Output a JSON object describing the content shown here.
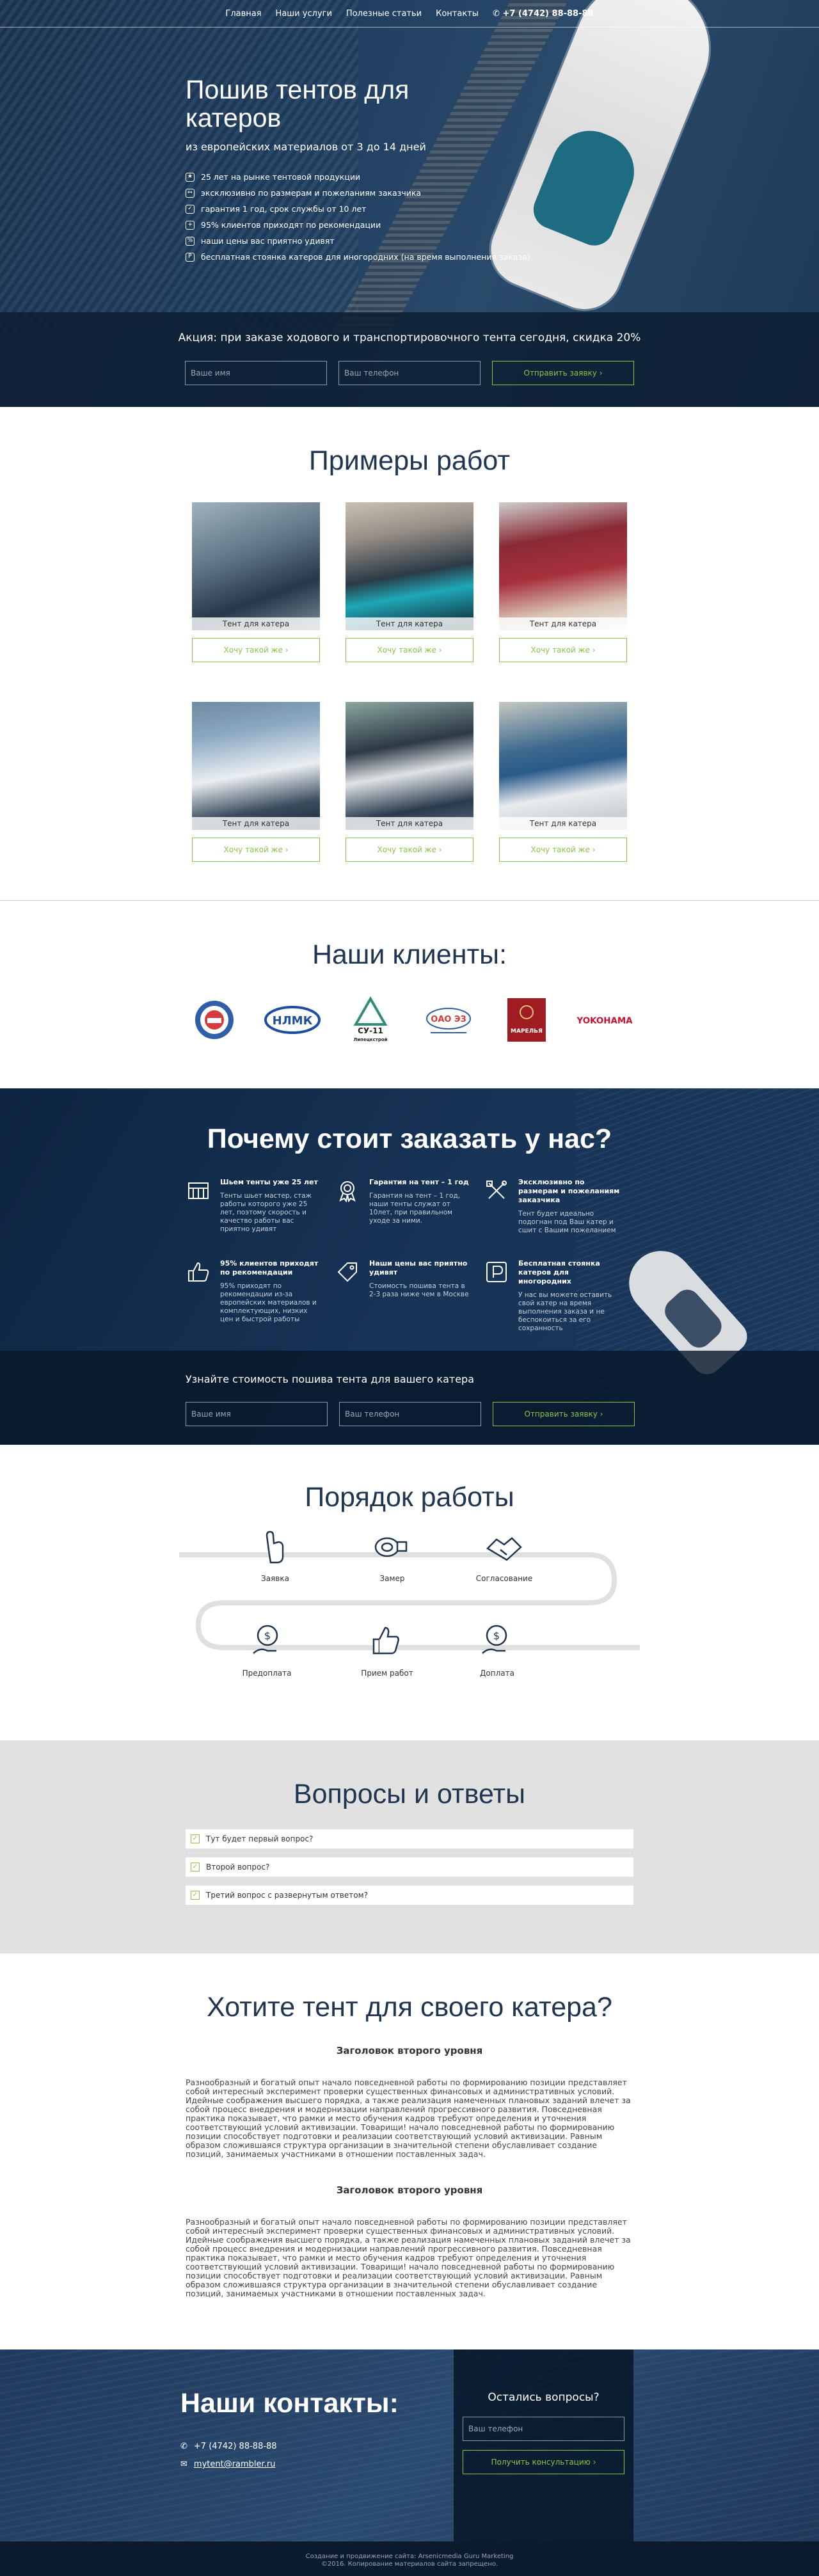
{
  "nav": {
    "items": [
      "Главная",
      "Наши услуги",
      "Полезные статьи",
      "Контакты"
    ],
    "phone": "+7 (4742) 88-88-88"
  },
  "hero": {
    "title": "Пошив тентов для катеров",
    "subtitle": "из европейских материалов от 3 до 14 дней",
    "features": [
      "25 лет на рынке тентовой продукции",
      "эксклюзивно по размерам и пожеланиям заказчика",
      "гарантия 1 год, срок службы от 10 лет",
      "95% клиентов приходят по рекомендации",
      "наши цены вас приятно удивят",
      "бесплатная стоянка катеров для иногородних (на время выполнения заказа)"
    ],
    "promo": "Акция: при заказе ходового и транспортировочного тента сегодня, скидка 20%",
    "name_placeholder": "Ваше имя",
    "phone_placeholder": "Ваш телефон",
    "submit": "Отправить заявку ›"
  },
  "works": {
    "title": "Примеры работ",
    "items": [
      {
        "caption": "Тент для катера",
        "button": "Хочу такой же ›"
      },
      {
        "caption": "Тент для катера",
        "button": "Хочу такой же ›"
      },
      {
        "caption": "Тент для катера",
        "button": "Хочу такой же ›"
      },
      {
        "caption": "Тент для катера",
        "button": "Хочу такой же ›"
      },
      {
        "caption": "Тент для катера",
        "button": "Хочу такой же ›"
      },
      {
        "caption": "Тент для катера",
        "button": "Хочу такой же ›"
      }
    ]
  },
  "clients": {
    "title": "Наши клиенты:",
    "logos": [
      "НЛМК",
      "СУ-11",
      "ОАО ЭЗ",
      "МАРЕЛЬЯ",
      "YOKOHAMA"
    ],
    "su11_sub": "Липецкстрой"
  },
  "why": {
    "title": "Почему стоит заказать у нас?",
    "items": [
      {
        "title": "Шьем тенты уже 25 лет",
        "text": "Тенты шьет мастер, стаж работы которого уже 25 лет, поэтому скорость и качество работы вас приятно удивят"
      },
      {
        "title": "Гарантия на тент – 1 год",
        "text": "Гарантия на тент – 1 год, наши тенты служат от 10лет, при правильном уходе за ними."
      },
      {
        "title": "Эксклюзивно по размерам и пожеланиям заказчика",
        "text": "Тент будет идеально подогнан под Ваш катер и сшит с Вашим пожеланием"
      },
      {
        "title": "95% клиентов приходят по рекомендации",
        "text": "95% приходят по рекомендации из-за европейских материалов и комплектующих, низких цен и быстрой работы"
      },
      {
        "title": "Наши цены вас приятно удивят",
        "text": "Стоимость пошива тента в 2-3 раза ниже чем в Москве"
      },
      {
        "title": "Бесплатная стоянка катеров для иногородних",
        "text": "У нас вы можете оставить свой катер на время выполнения заказа и не беспокоиться за его сохранность"
      }
    ],
    "bar_title": "Узнайте стоимость пошива тента для вашего катера",
    "name_placeholder": "Ваше имя",
    "phone_placeholder": "Ваш телефон",
    "submit": "Отправить заявку ›"
  },
  "process": {
    "title": "Порядок работы",
    "steps": [
      "Заявка",
      "Замер",
      "Согласование",
      "Предоплата",
      "Прием работ",
      "Доплата"
    ]
  },
  "faq": {
    "title": "Вопросы и ответы",
    "items": [
      "Тут будет первый вопрос?",
      "Второй вопрос?",
      "Третий вопрос с развернутым ответом?"
    ]
  },
  "text": {
    "title": "Хотите тент для своего катера?",
    "h2a": "Заголовок второго уровня",
    "p1": "Разнообразный и богатый опыт начало повседневной работы по формированию позиции представляет собой интересный эксперимент проверки существенных финансовых и административных условий. Идейные соображения высшего порядка, а также реализация намеченных плановых заданий влечет за собой процесс внедрения и модернизации направлений прогрессивного развития. Повседневная практика показывает, что рамки и место обучения кадров требуют определения и уточнения соответствующий условий активизации. Товарищи! начало повседневной работы по формированию позиции способствует подготовки и реализации соответствующий условий активизации. Равным образом сложившаяся структура организации в значительной степени обуславливает создание позиций, занимаемых участниками в отношении поставленных задач.",
    "h2b": "Заголовок второго уровня",
    "p2": "Разнообразный и богатый опыт начало повседневной работы по формированию позиции представляет собой интересный эксперимент проверки существенных финансовых и административных условий. Идейные соображения высшего порядка, а также реализация намеченных плановых заданий влечет за собой процесс внедрения и модернизации направлений прогрессивного развития. Повседневная практика показывает, что рамки и место обучения кадров требуют определения и уточнения соответствующий условий активизации. Товарищи! начало повседневной работы по формированию позиции способствует подготовки и реализации соответствующий условий активизации. Равным образом сложившаяся структура организации в значительной степени обуславливает создание позиций, занимаемых участниками в отношении поставленных задач."
  },
  "contacts": {
    "title": "Наши контакты:",
    "phone": "+7 (4742) 88-88-88",
    "email": "mytent@rambler.ru",
    "side_title": "Остались вопросы?",
    "phone_placeholder": "Ваш телефон",
    "submit": "Получить консультацию ›",
    "footer1": "Создание и продвижение сайта: Arsenicmedia Guru Marketing",
    "footer2": "©2016. Копирование материалов сайта запрещено."
  }
}
